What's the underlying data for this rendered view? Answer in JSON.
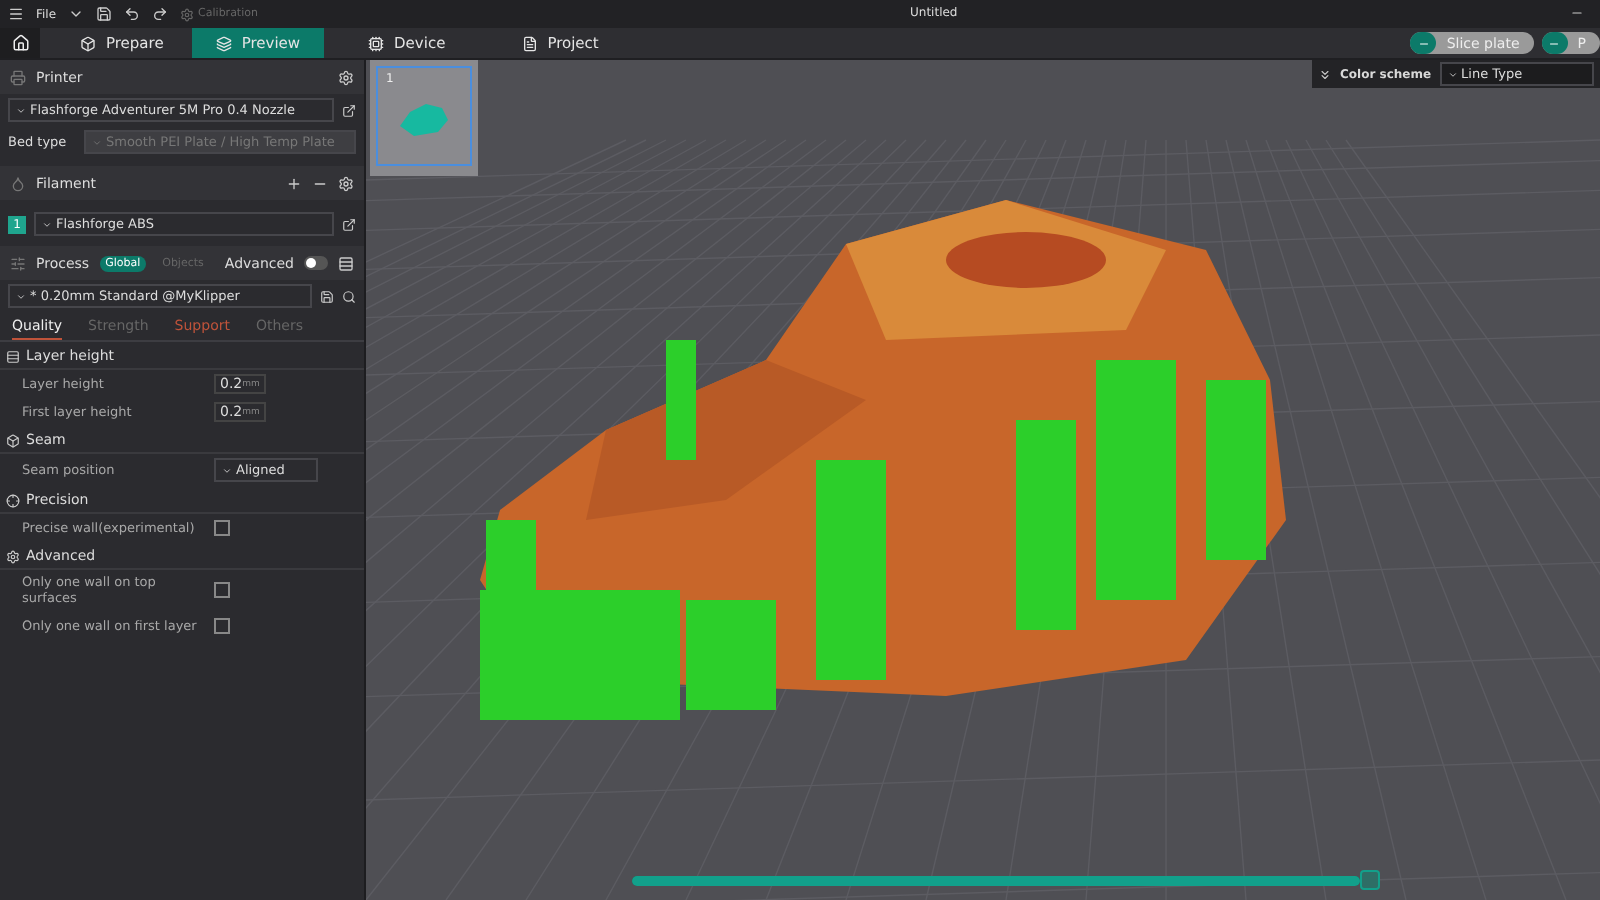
{
  "menu_bar": {
    "file_label": "File",
    "calibration_label": "Calibration",
    "title": "Untitled"
  },
  "nav_tabs": [
    {
      "label": "Prepare",
      "selected": false
    },
    {
      "label": "Preview",
      "selected": true
    },
    {
      "label": "Device",
      "selected": false
    },
    {
      "label": "Project",
      "selected": false
    }
  ],
  "actions": [
    {
      "label": "Slice plate"
    },
    {
      "label": "P"
    }
  ],
  "printer": {
    "title": "Printer",
    "preset": "Flashforge Adventurer 5M Pro 0.4 Nozzle",
    "bed_type_label": "Bed type",
    "bed_type": "Smooth PEI Plate / High Temp Plate"
  },
  "filament": {
    "title": "Filament",
    "items": [
      {
        "index": "1",
        "name": "Flashforge ABS",
        "color": "#1fa58e"
      }
    ]
  },
  "process": {
    "title": "Process",
    "scopes": [
      {
        "label": "Global",
        "selected": true
      },
      {
        "label": "Objects",
        "selected": false
      }
    ],
    "advanced_label": "Advanced",
    "advanced_on": false,
    "preset": "* 0.20mm Standard @MyKlipper"
  },
  "setting_tabs": [
    {
      "label": "Quality",
      "selected": true,
      "modified": false
    },
    {
      "label": "Strength",
      "selected": false,
      "modified": false
    },
    {
      "label": "Support",
      "selected": false,
      "modified": true
    },
    {
      "label": "Others",
      "selected": false,
      "modified": false
    }
  ],
  "groups": [
    {
      "title": "Layer height",
      "settings": [
        {
          "kind": "number",
          "label": "Layer height",
          "value": "0.2",
          "unit": "mm"
        },
        {
          "kind": "number",
          "label": "First layer height",
          "value": "0.2",
          "unit": "mm"
        }
      ]
    },
    {
      "title": "Seam",
      "settings": [
        {
          "kind": "select",
          "label": "Seam position",
          "value": "Aligned"
        }
      ]
    },
    {
      "title": "Precision",
      "settings": [
        {
          "kind": "checkbox",
          "label": "Precise wall(experimental)",
          "checked": false
        }
      ]
    },
    {
      "title": "Advanced",
      "settings": [
        {
          "kind": "checkbox",
          "label": "Only one wall on top surfaces",
          "checked": false
        },
        {
          "kind": "checkbox",
          "label": "Only one wall on first layer",
          "checked": false
        }
      ]
    }
  ],
  "plate": {
    "number": "1",
    "selected": true
  },
  "color_scheme": {
    "label": "Color scheme",
    "value": "Line Type"
  },
  "layer_slider": {
    "level": 1
  }
}
